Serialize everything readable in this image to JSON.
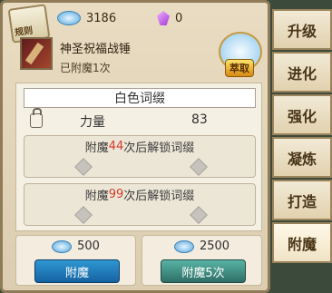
{
  "top": {
    "rules_label": "规则",
    "gem_count": "3186",
    "crystal_count": "0",
    "extract_label": "萃取"
  },
  "item": {
    "name": "神圣祝福战锤",
    "enchant_status": "已附魔1次"
  },
  "panel": {
    "title": "白色词缀",
    "stat_label": "力量",
    "stat_value": "83",
    "unlock1_prefix": "附魔",
    "unlock1_num": "44",
    "unlock1_suffix": "次后解锁词缀",
    "unlock2_prefix": "附魔",
    "unlock2_num": "99",
    "unlock2_suffix": "次后解锁词缀"
  },
  "actions": {
    "cost1": "500",
    "cost2": "2500",
    "enchant_label": "附魔",
    "enchant5_label": "附魔5次"
  },
  "tabs": [
    "升级",
    "进化",
    "强化",
    "凝炼",
    "打造",
    "附魔"
  ],
  "colors": {
    "accent": "#d23b2e"
  }
}
